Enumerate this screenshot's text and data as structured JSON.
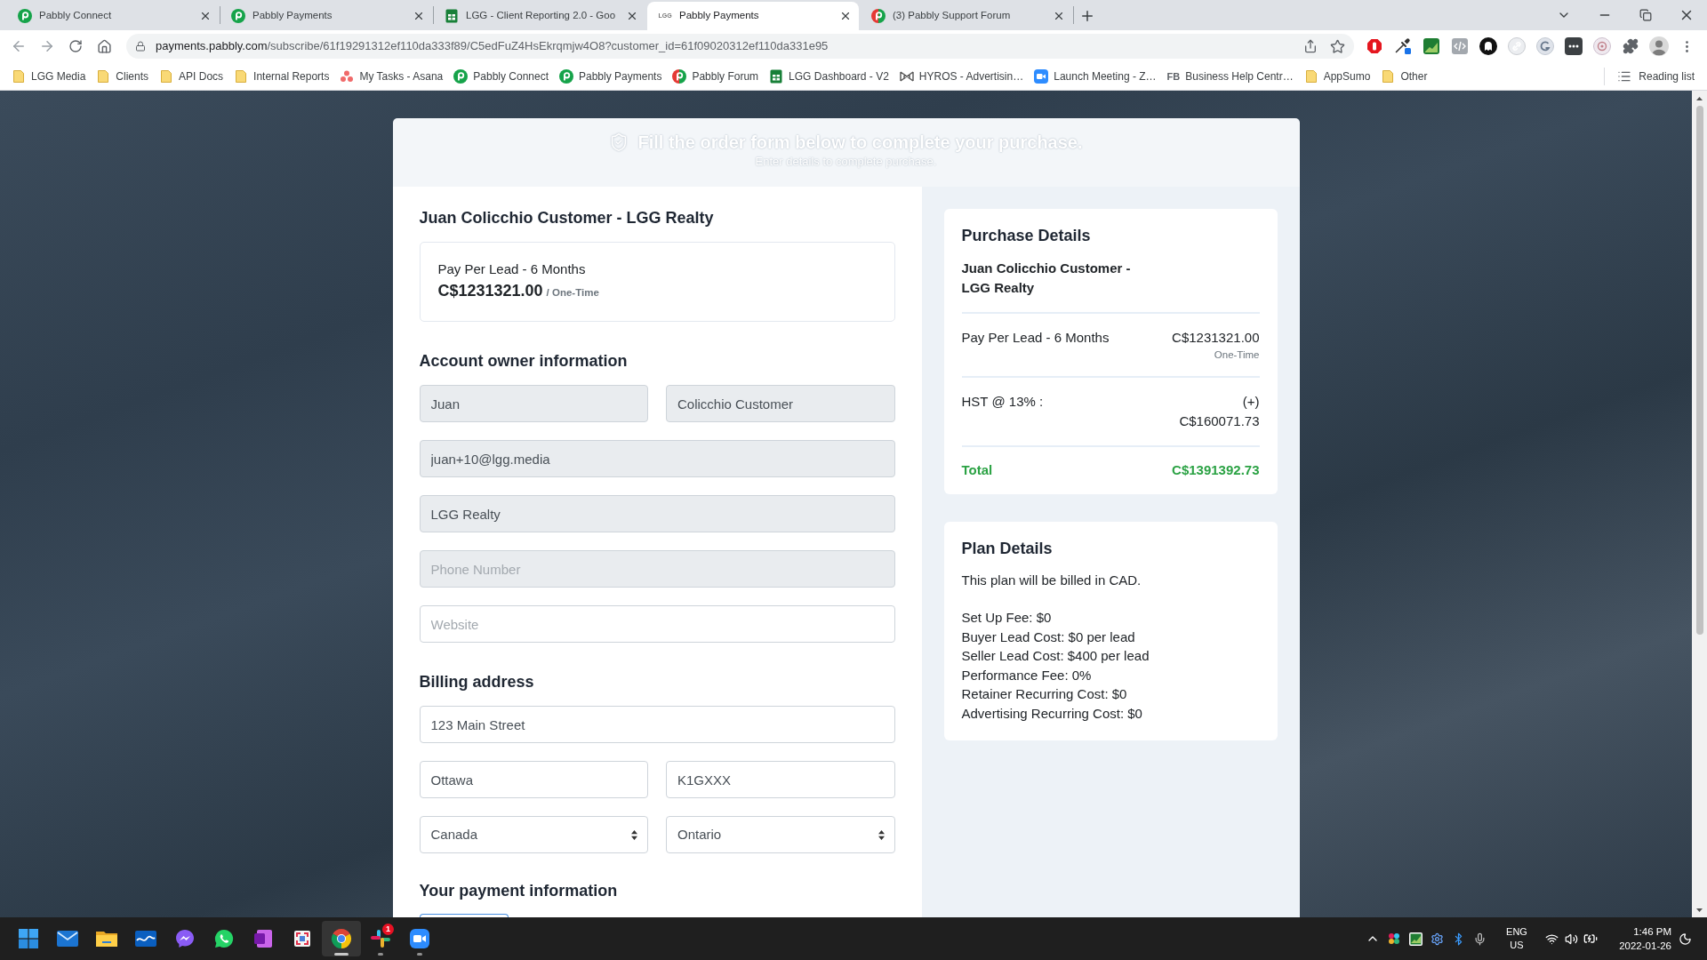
{
  "browser": {
    "tabs": [
      {
        "title": "Pabbly Connect",
        "kind": "pabbly",
        "selected": false
      },
      {
        "title": "Pabbly Payments",
        "kind": "pabbly",
        "selected": false
      },
      {
        "title": "LGG - Client Reporting 2.0 - Goo",
        "kind": "sheets",
        "selected": false
      },
      {
        "title": "Pabbly Payments",
        "kind": "text",
        "icon_text": "LGG",
        "selected": true
      },
      {
        "title": "(3) Pabbly Support Forum",
        "kind": "forum",
        "selected": false
      }
    ],
    "address": {
      "host": "payments.pabbly.com",
      "path": "/subscribe/61f19291312ef110da333f89/C5edFuZ4HsEkrqmjw4O8?customer_id=61f09020312ef110da331e95"
    },
    "bookmarks": [
      {
        "label": "LGG Media",
        "kind": "folder"
      },
      {
        "label": "Clients",
        "kind": "folder"
      },
      {
        "label": "API Docs",
        "kind": "folder"
      },
      {
        "label": "Internal Reports",
        "kind": "folder"
      },
      {
        "label": "My Tasks - Asana",
        "kind": "asana"
      },
      {
        "label": "Pabbly Connect",
        "kind": "pabbly"
      },
      {
        "label": "Pabbly Payments",
        "kind": "pabbly"
      },
      {
        "label": "Pabbly Forum",
        "kind": "forum"
      },
      {
        "label": "LGG Dashboard - V2",
        "kind": "sheets"
      },
      {
        "label": "HYROS - Advertisin…",
        "kind": "hyros"
      },
      {
        "label": "Launch Meeting - Z…",
        "kind": "zoom"
      },
      {
        "label": "Business Help Centr…",
        "kind": "text",
        "icon_text": "FB"
      },
      {
        "label": "AppSumo",
        "kind": "folder"
      },
      {
        "label": "Other",
        "kind": "folder"
      }
    ],
    "reading_list": "Reading list"
  },
  "page": {
    "header": {
      "title": "Fill the order form below to complete your purchase.",
      "subtitle": "Enter details to complete purchase."
    },
    "product_title": "Juan Colicchio Customer - LGG Realty",
    "plan": {
      "name": "Pay Per Lead - 6 Months",
      "price": "C$1231321.00",
      "billing": "/ One-Time"
    },
    "account_owner": {
      "heading": "Account owner information",
      "rows": [
        [
          {
            "kind": "input",
            "value": "Juan",
            "disabled": true
          },
          {
            "kind": "input",
            "value": "Colicchio Customer",
            "disabled": true
          }
        ],
        [
          {
            "kind": "input",
            "value": "juan+10@lgg.media",
            "disabled": true
          }
        ],
        [
          {
            "kind": "input",
            "value": "LGG Realty",
            "disabled": true
          }
        ],
        [
          {
            "kind": "input",
            "placeholder": "Phone Number",
            "disabled": true
          }
        ],
        [
          {
            "kind": "input",
            "placeholder": "Website",
            "disabled": false
          }
        ]
      ]
    },
    "billing_address": {
      "heading": "Billing address",
      "rows": [
        [
          {
            "kind": "input",
            "value": "123 Main Street",
            "disabled": false
          }
        ],
        [
          {
            "kind": "input",
            "value": "Ottawa",
            "disabled": false
          },
          {
            "kind": "input",
            "value": "K1GXXX",
            "disabled": false
          }
        ],
        [
          {
            "kind": "select",
            "value": "Canada",
            "disabled": false
          },
          {
            "kind": "select",
            "value": "Ontario",
            "disabled": false
          }
        ]
      ]
    },
    "payment": {
      "heading": "Your payment information",
      "methods": [
        {
          "selected": true
        }
      ]
    },
    "purchase_details": {
      "title": "Purchase Details",
      "product": "Juan Colicchio Customer - LGG Realty",
      "items": [
        {
          "label": "Pay Per Lead - 6 Months",
          "amount": "C$1231321.00",
          "note": "One-Time"
        },
        {
          "label": "HST @ 13% :",
          "sign": "(+)",
          "amount": "C$160071.73"
        }
      ],
      "total": {
        "label": "Total",
        "amount": "C$1391392.73"
      }
    },
    "plan_details": {
      "title": "Plan Details",
      "intro": "This plan will be billed in CAD.",
      "lines": [
        "Set Up Fee: $0",
        "Buyer Lead Cost: $0 per lead",
        "Seller Lead Cost: $400 per lead",
        "Performance Fee: 0%",
        "Retainer Recurring Cost: $0",
        "Advertising Recurring Cost: $0"
      ]
    }
  },
  "taskbar": {
    "apps": [
      {
        "kind": "start",
        "running": false,
        "selected": false
      },
      {
        "kind": "mail",
        "running": false,
        "selected": false
      },
      {
        "kind": "files",
        "running": false,
        "selected": false
      },
      {
        "kind": "inbox",
        "running": false,
        "selected": false
      },
      {
        "kind": "messenger",
        "running": false,
        "selected": false
      },
      {
        "kind": "whatsapp",
        "running": false,
        "selected": false
      },
      {
        "kind": "onenote",
        "running": false,
        "selected": false
      },
      {
        "kind": "snip",
        "running": false,
        "selected": false
      },
      {
        "kind": "chrome",
        "running": true,
        "selected": true
      },
      {
        "kind": "slack",
        "running": true,
        "selected": false,
        "badge": "1"
      },
      {
        "kind": "zoom",
        "running": true,
        "selected": false
      }
    ],
    "tray": {
      "language": "ENG",
      "region": "US",
      "time": "1:46 PM",
      "date": "2022-01-26"
    }
  }
}
